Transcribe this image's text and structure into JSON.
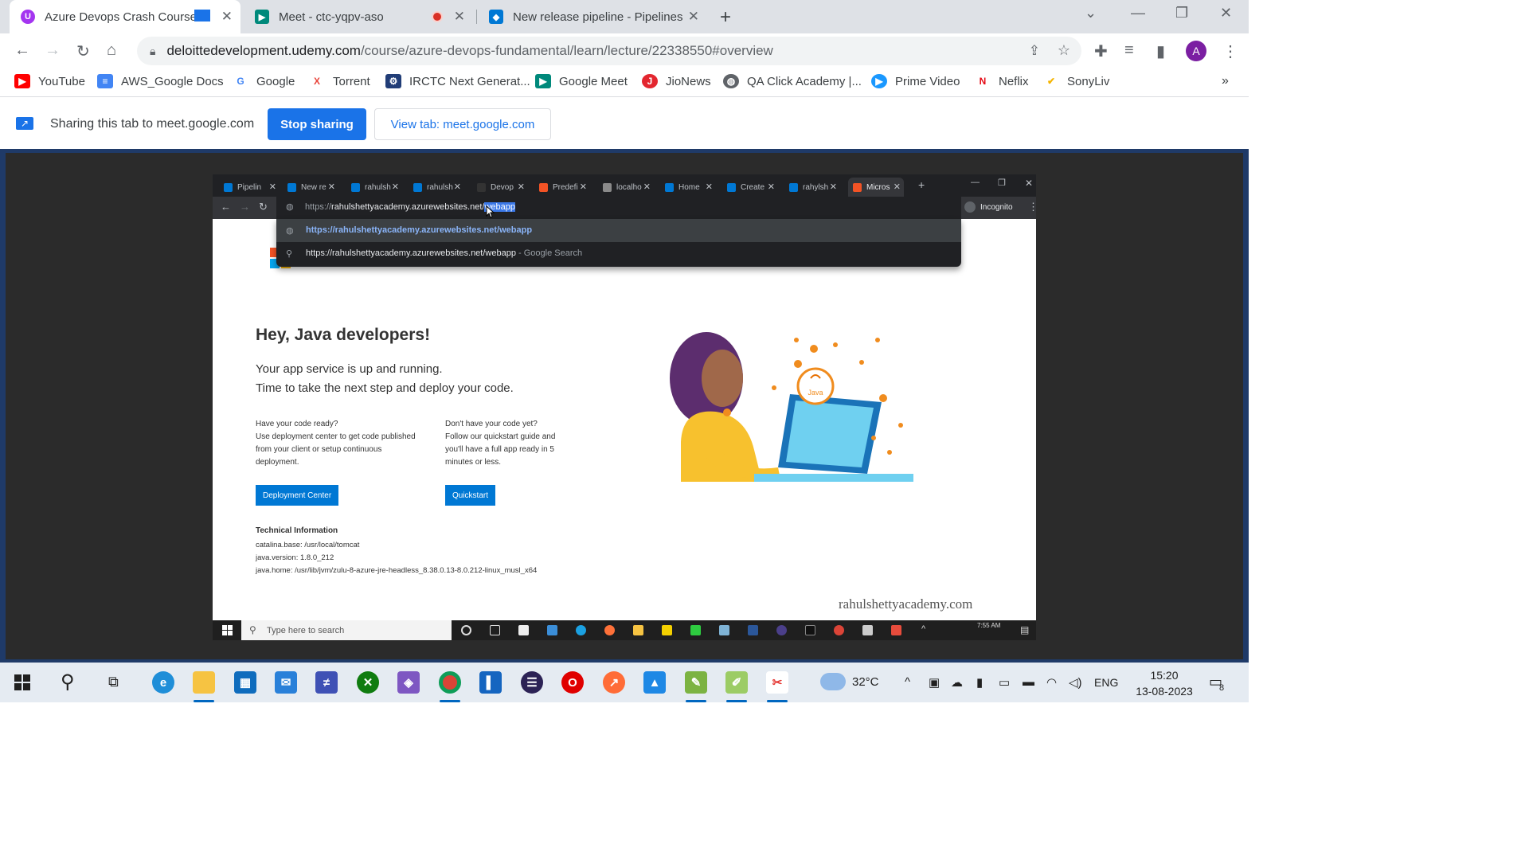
{
  "browser": {
    "tabs": [
      {
        "title": "Azure Devops Crash Course",
        "active": true,
        "icon": "udemy-icon",
        "color": "#a435f0"
      },
      {
        "title": "Meet - ctc-yqpv-aso",
        "active": false,
        "icon": "google-meet-icon",
        "color": "#00897b"
      },
      {
        "title": "New release pipeline - Pipelines",
        "active": false,
        "icon": "azure-devops-icon",
        "color": "#0078d4"
      }
    ],
    "url_host": "deloittedevelopment.udemy.com",
    "url_path": "/course/azure-devops-fundamental/learn/lecture/22338550#overview",
    "profile_initial": "A",
    "bookmarks": [
      {
        "label": "YouTube",
        "icon": "youtube-icon",
        "color": "#ff0000"
      },
      {
        "label": "AWS_Google Docs",
        "icon": "docs-icon",
        "color": "#4285f4"
      },
      {
        "label": "Google",
        "icon": "google-icon",
        "color": "#4285f4"
      },
      {
        "label": "Torrent",
        "icon": "torrent-icon",
        "color": "#e8453c"
      },
      {
        "label": "IRCTC Next Generat...",
        "icon": "irctc-icon",
        "color": "#213d77"
      },
      {
        "label": "Google Meet",
        "icon": "google-meet-icon",
        "color": "#00897b"
      },
      {
        "label": "JioNews",
        "icon": "jionews-icon",
        "color": "#e3262f"
      },
      {
        "label": "QA Click Academy |...",
        "icon": "globe-icon",
        "color": "#5f6368"
      },
      {
        "label": "Prime Video",
        "icon": "prime-video-icon",
        "color": "#1a98ff"
      },
      {
        "label": "Neflix",
        "icon": "netflix-icon",
        "color": "#e50914"
      },
      {
        "label": "SonyLiv",
        "icon": "sonyliv-icon",
        "color": "#f5b400"
      }
    ]
  },
  "sharing": {
    "text": "Sharing this tab to meet.google.com",
    "stop_label": "Stop sharing",
    "view_label": "View tab: meet.google.com"
  },
  "inner_browser": {
    "tabs": [
      "Pipelin",
      "New re",
      "rahulsh",
      "rahulsh",
      "Devop",
      "Predefi",
      "localho",
      "Home",
      "Create",
      "rahylsh",
      "Micros"
    ],
    "url_prefix": "https://",
    "url_host": "rahulshettyacademy.azurewebsites.net/",
    "url_selected": "webapp",
    "incognito_label": "Incognito",
    "suggestions": [
      {
        "text": "https://rahulshettyacademy.azurewebsites.net/webapp",
        "suffix": ""
      },
      {
        "text": "https://rahulshettyacademy.azurewebsites.net/webapp",
        "suffix": " - Google Search"
      }
    ]
  },
  "azure_page": {
    "title": "Hey, Java developers!",
    "subtitle_1": "Your app service is up and running.",
    "subtitle_2": "Time to take the next step and deploy your code.",
    "col1": {
      "heading": "Have your code ready?",
      "body": "Use deployment center to get code published from your client or setup continuous deployment.",
      "button": "Deployment Center"
    },
    "col2": {
      "heading": "Don't have your code yet?",
      "body": "Follow our quickstart guide and you'll have a full app ready in 5 minutes or less.",
      "button": "Quickstart"
    },
    "tech_heading": "Technical Information",
    "tech_lines": [
      "catalina.base: /usr/local/tomcat",
      "java.version: 1.8.0_212",
      "java.home: /usr/lib/jvm/zulu-8-azure-jre-headless_8.38.0.13-8.0.212-linux_musl_x64"
    ],
    "java_badge": "Java",
    "watermark": "rahulshettyacademy.com"
  },
  "inner_taskbar": {
    "search_placeholder": "Type here to search",
    "clock_time": "7:55 AM"
  },
  "taskbar": {
    "temperature": "32°C",
    "language": "ENG",
    "time": "15:20",
    "date": "13-08-2023",
    "notification_count": "8"
  },
  "colors": {
    "chrome_blue": "#1a73e8",
    "azure_blue": "#0078d4",
    "share_frame": "#1f3a68"
  }
}
